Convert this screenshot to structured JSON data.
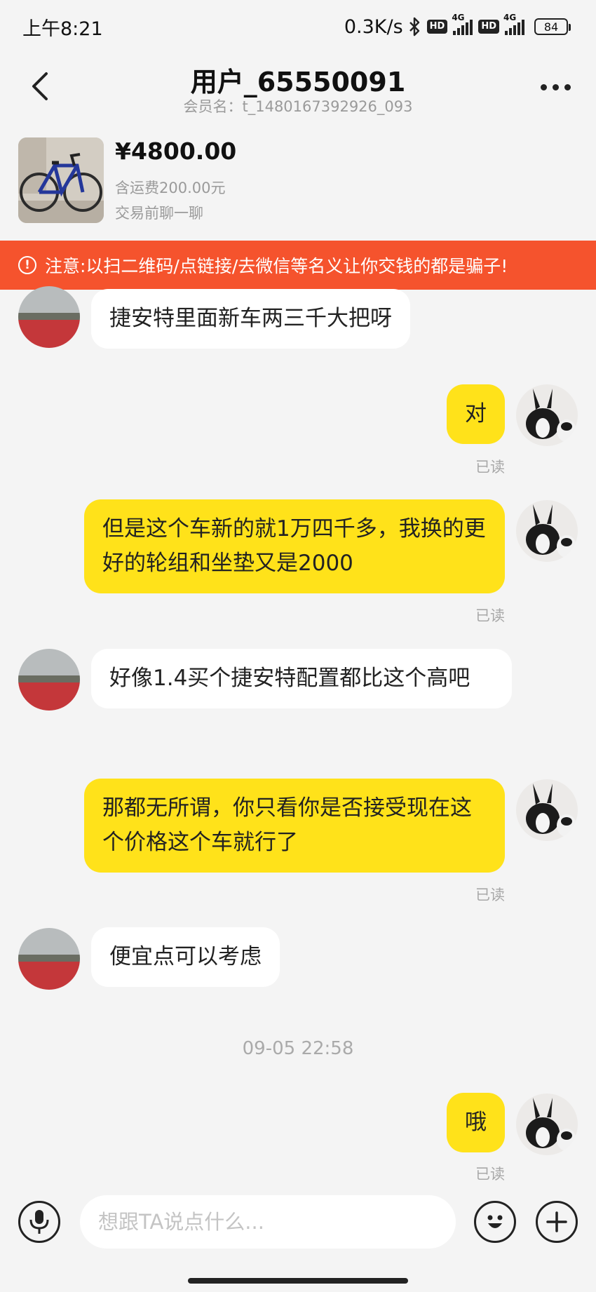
{
  "status_bar": {
    "time": "上午8:21",
    "speed": "0.3K/s",
    "hd": "HD",
    "network": "4G",
    "battery": "84"
  },
  "header": {
    "title": "用户_65550091",
    "member": "会员名：t_1480167392926_093"
  },
  "product": {
    "price": "¥4800.00",
    "shipping": "含运费200.00元",
    "note": "交易前聊一聊"
  },
  "warning": "注意:以扫二维码/点链接/去微信等名义让你交钱的都是骗子!",
  "messages": [
    {
      "from": "other",
      "text": "捷安特里面新车两三千大把呀"
    },
    {
      "from": "me",
      "text": "对",
      "status": "已读"
    },
    {
      "from": "me",
      "text": "但是这个车新的就1万四千多，我换的更好的轮组和坐垫又是2000",
      "status": "已读"
    },
    {
      "from": "other",
      "text": "好像1.4买个捷安特配置都比这个高吧"
    },
    {
      "from": "me",
      "text": "那都无所谓，你只看你是否接受现在这个价格这个车就行了",
      "status": "已读"
    },
    {
      "from": "other",
      "text": "便宜点可以考虑"
    },
    {
      "from": "time",
      "text": "09-05 22:58"
    },
    {
      "from": "me",
      "text": "哦",
      "status": "已读"
    }
  ],
  "input": {
    "placeholder": "想跟TA说点什么..."
  },
  "colors": {
    "accent_yellow": "#ffe21a",
    "warning_red": "#f5532d",
    "background": "#f4f4f4"
  },
  "icons": [
    "back-chevron-icon",
    "more-dots-icon",
    "warning-circle-icon",
    "microphone-icon",
    "emoji-icon",
    "plus-icon",
    "bluetooth-icon"
  ]
}
